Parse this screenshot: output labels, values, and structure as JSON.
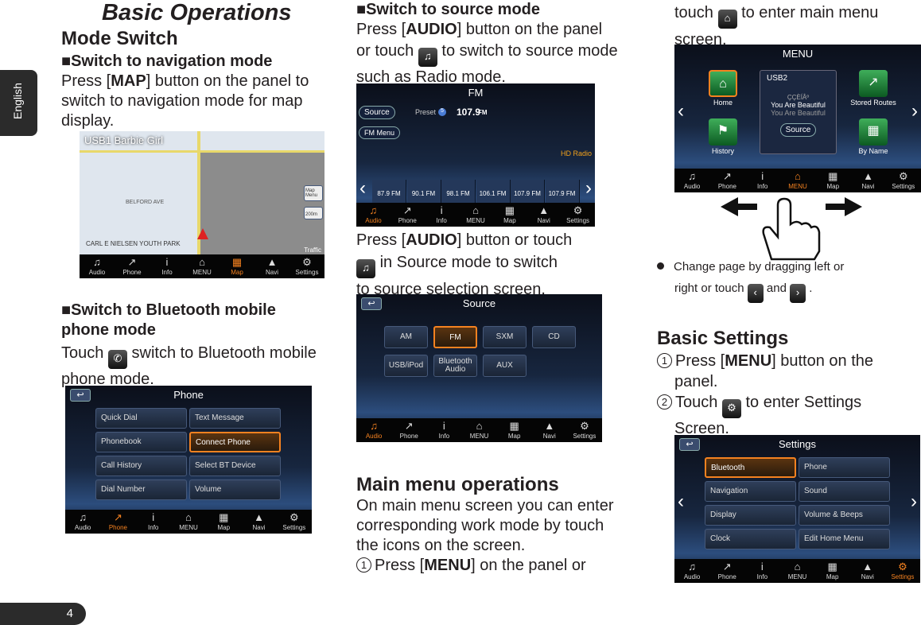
{
  "side_tab": "English",
  "page_number": "4",
  "title": "Basic Operations",
  "mode_switch": {
    "heading": "Mode Switch",
    "nav": {
      "heading": "■Switch to navigation mode",
      "l1a": "Press [",
      "l1b": "MAP",
      "l1c": "] button on the panel to",
      "l2": "switch to navigation mode for map",
      "l3": "display."
    },
    "bt": {
      "heading1": "■Switch to Bluetooth mobile",
      "heading2": "phone mode",
      "l1a": "Touch",
      "l1b": "switch to Bluetooth mobile",
      "l2": "phone mode."
    }
  },
  "source": {
    "heading": "■Switch to source mode",
    "l1a": "Press [",
    "l1b": "AUDIO",
    "l1c": "] button on the panel",
    "l2a": "or touch",
    "l2b": "to switch to source mode",
    "l3": "such as Radio mode.",
    "m1a": "Press [",
    "m1b": "AUDIO",
    "m1c": "] button or touch",
    "m2": "in Source mode to switch",
    "m3": "to source selection screen."
  },
  "main_menu": {
    "heading": "Main menu operations",
    "l1": "On main menu screen you can enter",
    "l2": "corresponding work mode by touch",
    "l3": "the icons on the screen.",
    "s1n": "1",
    "s1a": "Press [",
    "s1b": "MENU",
    "s1c": "] on the panel or",
    "c1a": "touch",
    "c1b": "to enter main menu",
    "c2": "screen.",
    "bullet1": "Change page by dragging left or",
    "bullet2a": "right or touch",
    "bullet2b": "and",
    "bullet2c": "."
  },
  "basic_settings": {
    "heading": "Basic Settings",
    "s1n": "1",
    "s1a": "Press [",
    "s1b": "MENU",
    "s1c": "] button on the",
    "s1d": "panel.",
    "s2n": "2",
    "s2a": "Touch",
    "s2b": "to enter Settings",
    "s2c": "Screen."
  },
  "navbar": [
    "Audio",
    "Phone",
    "Info",
    "MENU",
    "Map",
    "Navi",
    "Settings"
  ],
  "navbar_icons": [
    "music-note-icon",
    "phone-icon",
    "info-icon",
    "home-icon",
    "map-icon",
    "navi-arrow-icon",
    "gear-icon"
  ],
  "accent_color": "#f58220",
  "screens": {
    "map": {
      "now_playing": "USB1 Barbie Girl",
      "street1": "BELFORD AVE",
      "park": "CARL E NIELSEN YOUTH PARK",
      "map_menu": "Map Menu",
      "scale": "200m",
      "traffic": "Traffic",
      "active": 4
    },
    "fm": {
      "title": "FM",
      "source_btn": "Source",
      "fm_menu_btn": "FM Menu",
      "preset_label": "Preset",
      "preset_num": "5",
      "freq": "107.9",
      "band": "FM",
      "hd": "HD Radio",
      "presets": [
        {
          "n": "1",
          "f": "87.9 FM"
        },
        {
          "n": "2",
          "f": "90.1 FM"
        },
        {
          "n": "3",
          "f": "98.1 FM"
        },
        {
          "n": "4",
          "f": "106.1 FM"
        },
        {
          "n": "5",
          "f": "107.9 FM"
        },
        {
          "n": "6",
          "f": "107.9 FM"
        }
      ],
      "active_preset": 4,
      "active": 0
    },
    "source": {
      "title": "Source",
      "items": [
        "AM",
        "FM",
        "SXM",
        "CD",
        "USB/iPod",
        "Bluetooth Audio",
        "AUX"
      ],
      "selected": 1,
      "active": 0
    },
    "phone": {
      "title": "Phone",
      "items": [
        "Quick Dial",
        "Text Message",
        "Phonebook",
        "Connect Phone",
        "Call History",
        "Select BT Device",
        "Dial Number",
        "Volume"
      ],
      "selected": 3,
      "active": 1
    },
    "menu": {
      "title": "MENU",
      "usb": "USB2",
      "artist": "ÇÇÈÍÂº",
      "song": "You Are Beautiful",
      "album": "You Are Beautiful",
      "source_btn": "Source",
      "items": [
        "Home",
        "History",
        "Stored Routes",
        "By Name"
      ],
      "active": 3
    },
    "settings": {
      "title": "Settings",
      "items": [
        "Bluetooth",
        "Phone",
        "Navigation",
        "Sound",
        "Display",
        "Volume & Beeps",
        "Clock",
        "Edit Home Menu"
      ],
      "selected": 0,
      "active": 6
    }
  }
}
